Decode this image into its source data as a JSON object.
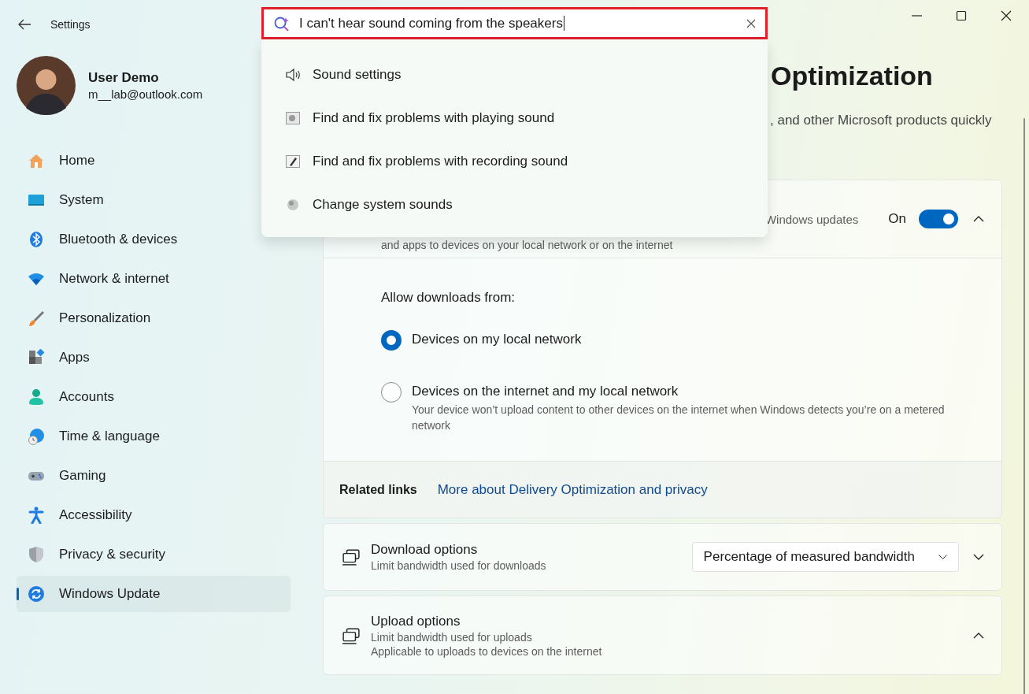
{
  "window": {
    "title": "Settings"
  },
  "profile": {
    "name": "User Demo",
    "email": "m__lab@outlook.com"
  },
  "nav": [
    {
      "label": "Home",
      "kind": "home",
      "selected": false
    },
    {
      "label": "System",
      "kind": "system",
      "selected": false
    },
    {
      "label": "Bluetooth & devices",
      "kind": "bluetooth",
      "selected": false
    },
    {
      "label": "Network & internet",
      "kind": "wifi",
      "selected": false
    },
    {
      "label": "Personalization",
      "kind": "brush",
      "selected": false
    },
    {
      "label": "Apps",
      "kind": "apps",
      "selected": false
    },
    {
      "label": "Accounts",
      "kind": "person",
      "selected": false
    },
    {
      "label": "Time & language",
      "kind": "globe",
      "selected": false
    },
    {
      "label": "Gaming",
      "kind": "gamepad",
      "selected": false
    },
    {
      "label": "Accessibility",
      "kind": "accessibility",
      "selected": false
    },
    {
      "label": "Privacy & security",
      "kind": "shield",
      "selected": false
    },
    {
      "label": "Windows Update",
      "kind": "update",
      "selected": true
    }
  ],
  "search": {
    "value": "I can't hear sound coming from the speakers"
  },
  "suggestions": [
    {
      "label": "Sound settings",
      "kind": "speaker"
    },
    {
      "label": "Find and fix problems with playing sound",
      "kind": "troubleshoot"
    },
    {
      "label": "Find and fix problems with recording sound",
      "kind": "pen"
    },
    {
      "label": "Change system sounds",
      "kind": "sound-sphere"
    }
  ],
  "page": {
    "title": "Optimization",
    "description": ", and other Microsoft products quickly"
  },
  "downloads_card": {
    "description_end": "Windows updates",
    "description": "and apps to devices on your local network or on the internet",
    "toggle_label": "On",
    "on": true,
    "expanded": true,
    "prompt": "Allow downloads from:",
    "options": [
      {
        "label": "Devices on my local network",
        "selected": true
      },
      {
        "label": "Devices on the internet and my local network",
        "detail": "Your device won’t upload content to other devices on the internet when Windows detects you’re on a metered network",
        "selected": false
      }
    ]
  },
  "related_links": {
    "label": "Related links",
    "links": [
      "More about Delivery Optimization and privacy"
    ]
  },
  "option_cards": [
    {
      "title": "Download options",
      "lines": [
        "Limit bandwidth used for downloads"
      ],
      "dropdown": "Percentage of measured bandwidth",
      "expanded": false
    },
    {
      "title": "Upload options",
      "lines": [
        "Limit bandwidth used for uploads",
        "Applicable to uploads to devices on the internet"
      ],
      "expanded": true
    }
  ]
}
